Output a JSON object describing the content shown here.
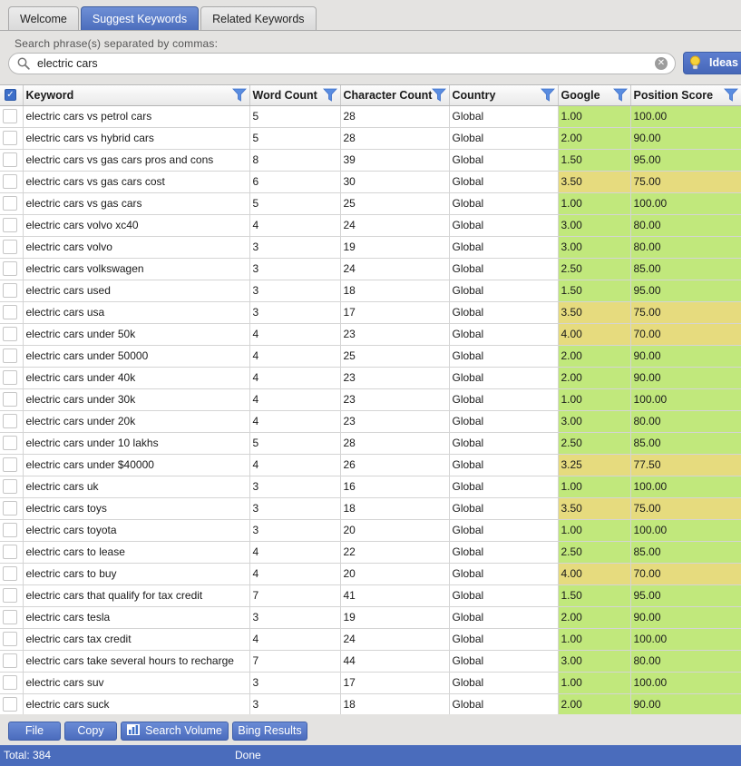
{
  "tabs": [
    {
      "label": "Welcome",
      "active": false
    },
    {
      "label": "Suggest Keywords",
      "active": true
    },
    {
      "label": "Related Keywords",
      "active": false
    }
  ],
  "search": {
    "label": "Search phrase(s) separated by commas:",
    "value": "electric cars",
    "ideas_label": "Ideas"
  },
  "grid": {
    "columns": [
      "Keyword",
      "Word Count",
      "Character Count",
      "Country",
      "Google",
      "Position Score"
    ],
    "rows": [
      {
        "keyword": "electric cars vs petrol cars",
        "words": "5",
        "chars": "28",
        "country": "Global",
        "google": "1.00",
        "score": "100.00",
        "tone": "g"
      },
      {
        "keyword": "electric cars vs hybrid cars",
        "words": "5",
        "chars": "28",
        "country": "Global",
        "google": "2.00",
        "score": "90.00",
        "tone": "g"
      },
      {
        "keyword": "electric cars vs gas cars pros and cons",
        "words": "8",
        "chars": "39",
        "country": "Global",
        "google": "1.50",
        "score": "95.00",
        "tone": "g"
      },
      {
        "keyword": "electric cars vs gas cars cost",
        "words": "6",
        "chars": "30",
        "country": "Global",
        "google": "3.50",
        "score": "75.00",
        "tone": "y"
      },
      {
        "keyword": "electric cars vs gas cars",
        "words": "5",
        "chars": "25",
        "country": "Global",
        "google": "1.00",
        "score": "100.00",
        "tone": "g"
      },
      {
        "keyword": "electric cars volvo xc40",
        "words": "4",
        "chars": "24",
        "country": "Global",
        "google": "3.00",
        "score": "80.00",
        "tone": "g"
      },
      {
        "keyword": "electric cars volvo",
        "words": "3",
        "chars": "19",
        "country": "Global",
        "google": "3.00",
        "score": "80.00",
        "tone": "g"
      },
      {
        "keyword": "electric cars volkswagen",
        "words": "3",
        "chars": "24",
        "country": "Global",
        "google": "2.50",
        "score": "85.00",
        "tone": "g"
      },
      {
        "keyword": "electric cars used",
        "words": "3",
        "chars": "18",
        "country": "Global",
        "google": "1.50",
        "score": "95.00",
        "tone": "g"
      },
      {
        "keyword": "electric cars usa",
        "words": "3",
        "chars": "17",
        "country": "Global",
        "google": "3.50",
        "score": "75.00",
        "tone": "y"
      },
      {
        "keyword": "electric cars under 50k",
        "words": "4",
        "chars": "23",
        "country": "Global",
        "google": "4.00",
        "score": "70.00",
        "tone": "y"
      },
      {
        "keyword": "electric cars under 50000",
        "words": "4",
        "chars": "25",
        "country": "Global",
        "google": "2.00",
        "score": "90.00",
        "tone": "g"
      },
      {
        "keyword": "electric cars under 40k",
        "words": "4",
        "chars": "23",
        "country": "Global",
        "google": "2.00",
        "score": "90.00",
        "tone": "g"
      },
      {
        "keyword": "electric cars under 30k",
        "words": "4",
        "chars": "23",
        "country": "Global",
        "google": "1.00",
        "score": "100.00",
        "tone": "g"
      },
      {
        "keyword": "electric cars under 20k",
        "words": "4",
        "chars": "23",
        "country": "Global",
        "google": "3.00",
        "score": "80.00",
        "tone": "g"
      },
      {
        "keyword": "electric cars under 10 lakhs",
        "words": "5",
        "chars": "28",
        "country": "Global",
        "google": "2.50",
        "score": "85.00",
        "tone": "g"
      },
      {
        "keyword": "electric cars under $40000",
        "words": "4",
        "chars": "26",
        "country": "Global",
        "google": "3.25",
        "score": "77.50",
        "tone": "y"
      },
      {
        "keyword": "electric cars uk",
        "words": "3",
        "chars": "16",
        "country": "Global",
        "google": "1.00",
        "score": "100.00",
        "tone": "g"
      },
      {
        "keyword": "electric cars toys",
        "words": "3",
        "chars": "18",
        "country": "Global",
        "google": "3.50",
        "score": "75.00",
        "tone": "y"
      },
      {
        "keyword": "electric cars toyota",
        "words": "3",
        "chars": "20",
        "country": "Global",
        "google": "1.00",
        "score": "100.00",
        "tone": "g"
      },
      {
        "keyword": "electric cars to lease",
        "words": "4",
        "chars": "22",
        "country": "Global",
        "google": "2.50",
        "score": "85.00",
        "tone": "g"
      },
      {
        "keyword": "electric cars to buy",
        "words": "4",
        "chars": "20",
        "country": "Global",
        "google": "4.00",
        "score": "70.00",
        "tone": "y"
      },
      {
        "keyword": "electric cars that qualify for tax credit",
        "words": "7",
        "chars": "41",
        "country": "Global",
        "google": "1.50",
        "score": "95.00",
        "tone": "g"
      },
      {
        "keyword": "electric cars tesla",
        "words": "3",
        "chars": "19",
        "country": "Global",
        "google": "2.00",
        "score": "90.00",
        "tone": "g"
      },
      {
        "keyword": "electric cars tax credit",
        "words": "4",
        "chars": "24",
        "country": "Global",
        "google": "1.00",
        "score": "100.00",
        "tone": "g"
      },
      {
        "keyword": "electric cars take several hours to recharge",
        "words": "7",
        "chars": "44",
        "country": "Global",
        "google": "3.00",
        "score": "80.00",
        "tone": "g"
      },
      {
        "keyword": "electric cars suv",
        "words": "3",
        "chars": "17",
        "country": "Global",
        "google": "1.00",
        "score": "100.00",
        "tone": "g"
      },
      {
        "keyword": "electric cars suck",
        "words": "3",
        "chars": "18",
        "country": "Global",
        "google": "2.00",
        "score": "90.00",
        "tone": "g"
      }
    ]
  },
  "toolbar": {
    "file": "File",
    "copy": "Copy",
    "search_volume": "Search Volume",
    "bing_results": "Bing Results"
  },
  "status": {
    "total": "Total: 384",
    "state": "Done"
  },
  "colors": {
    "accent": "#4a6cbc",
    "good": "#c1e87c",
    "medium": "#e6db7e"
  }
}
